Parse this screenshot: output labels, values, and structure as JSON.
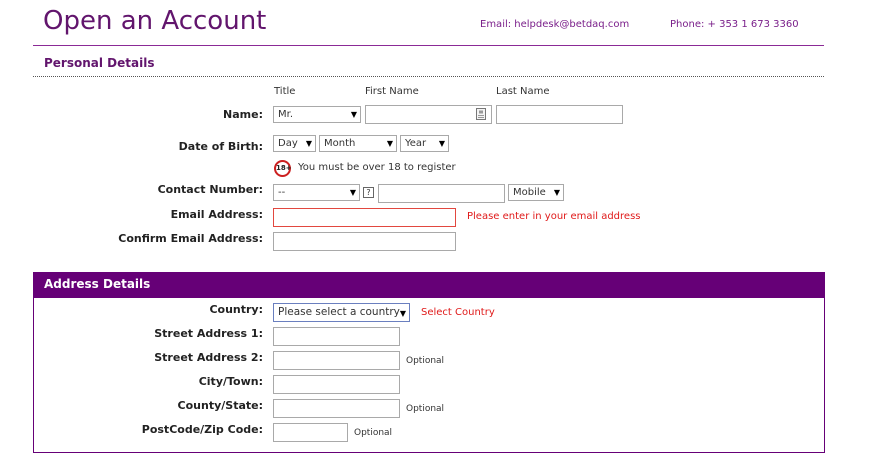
{
  "header": {
    "title": "Open an Account",
    "email": "Email: helpdesk@betdaq.com",
    "phone": "Phone: + 353 1 673 3360"
  },
  "personal": {
    "section_title": "Personal Details",
    "col_title": "Title",
    "col_first": "First Name",
    "col_last": "Last Name",
    "name_label": "Name:",
    "title_value": "Mr.",
    "dob_label": "Date of Birth:",
    "dob_day": "Day",
    "dob_month": "Month",
    "dob_year": "Year",
    "age_badge": "18+",
    "age_note": "You must be over 18 to register",
    "contact_label": "Contact Number:",
    "contact_code": "--",
    "help_mark": "?",
    "phone_type": "Mobile",
    "email_label": "Email Address:",
    "email_error": "Please enter in your email address",
    "confirm_email_label": "Confirm Email Address:"
  },
  "address": {
    "section_title": "Address Details",
    "country_label": "Country:",
    "country_placeholder": "Please select a country",
    "country_error": "Select Country",
    "street1_label": "Street Address 1:",
    "street2_label": "Street Address 2:",
    "city_label": "City/Town:",
    "county_label": "County/State:",
    "postcode_label": "PostCode/Zip Code:",
    "optional": "Optional"
  },
  "colors": {
    "brand_purple": "#660077",
    "error_red": "#e01a1a"
  },
  "icons": {
    "dropdown": "chevron-down-icon",
    "help": "question-mark-icon",
    "age": "age-18-plus-icon",
    "field_picker": "contact-card-icon"
  }
}
